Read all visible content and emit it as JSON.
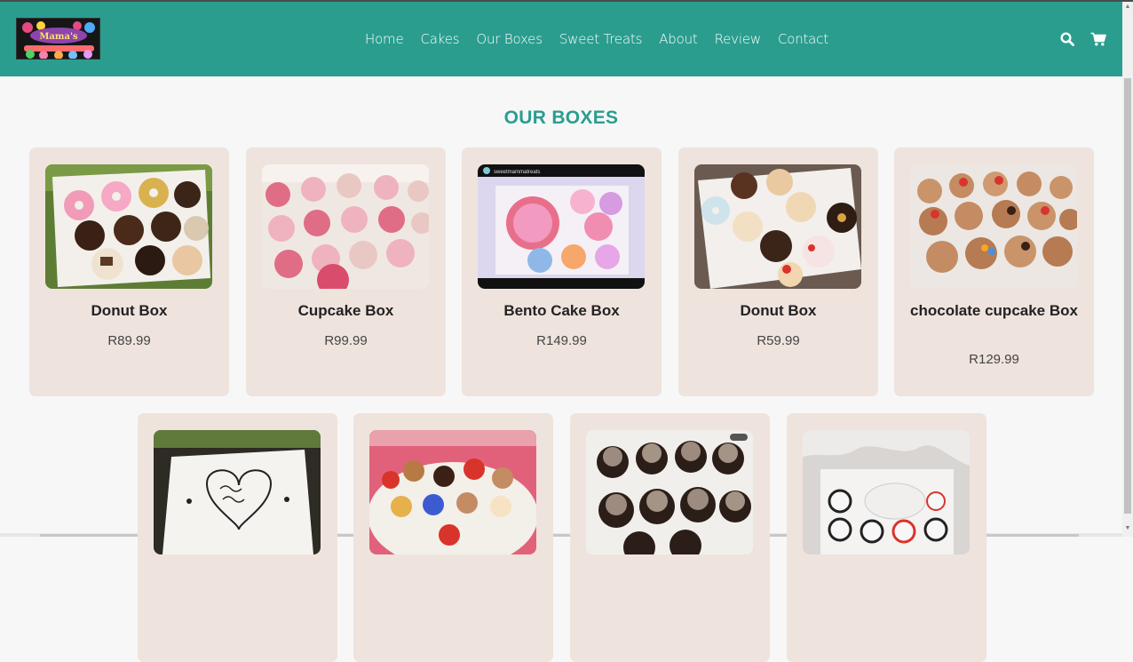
{
  "nav": {
    "links": [
      "Home",
      "Cakes",
      "Our Boxes",
      "Sweet Treats",
      "About",
      "Review",
      "Contact"
    ],
    "icons": [
      "search-icon",
      "cart-icon"
    ],
    "logo_icon": "bakery-logo",
    "color": "#2a9d8f"
  },
  "section": {
    "title": "OUR BOXES"
  },
  "products_row1": [
    {
      "name": "Donut Box",
      "price": "R89.99"
    },
    {
      "name": "Cupcake Box",
      "price": "R99.99"
    },
    {
      "name": "Bento Cake Box",
      "price": "R149.99",
      "image_caption": "sweetmammatreats"
    },
    {
      "name": "Donut Box",
      "price": "R59.99"
    },
    {
      "name": "chocolate cupcake Box",
      "price": "R129.99"
    }
  ],
  "colors": {
    "accent": "#2a9d8f",
    "card_bg": "#efe3dd",
    "page_bg": "#f7f7f7"
  }
}
